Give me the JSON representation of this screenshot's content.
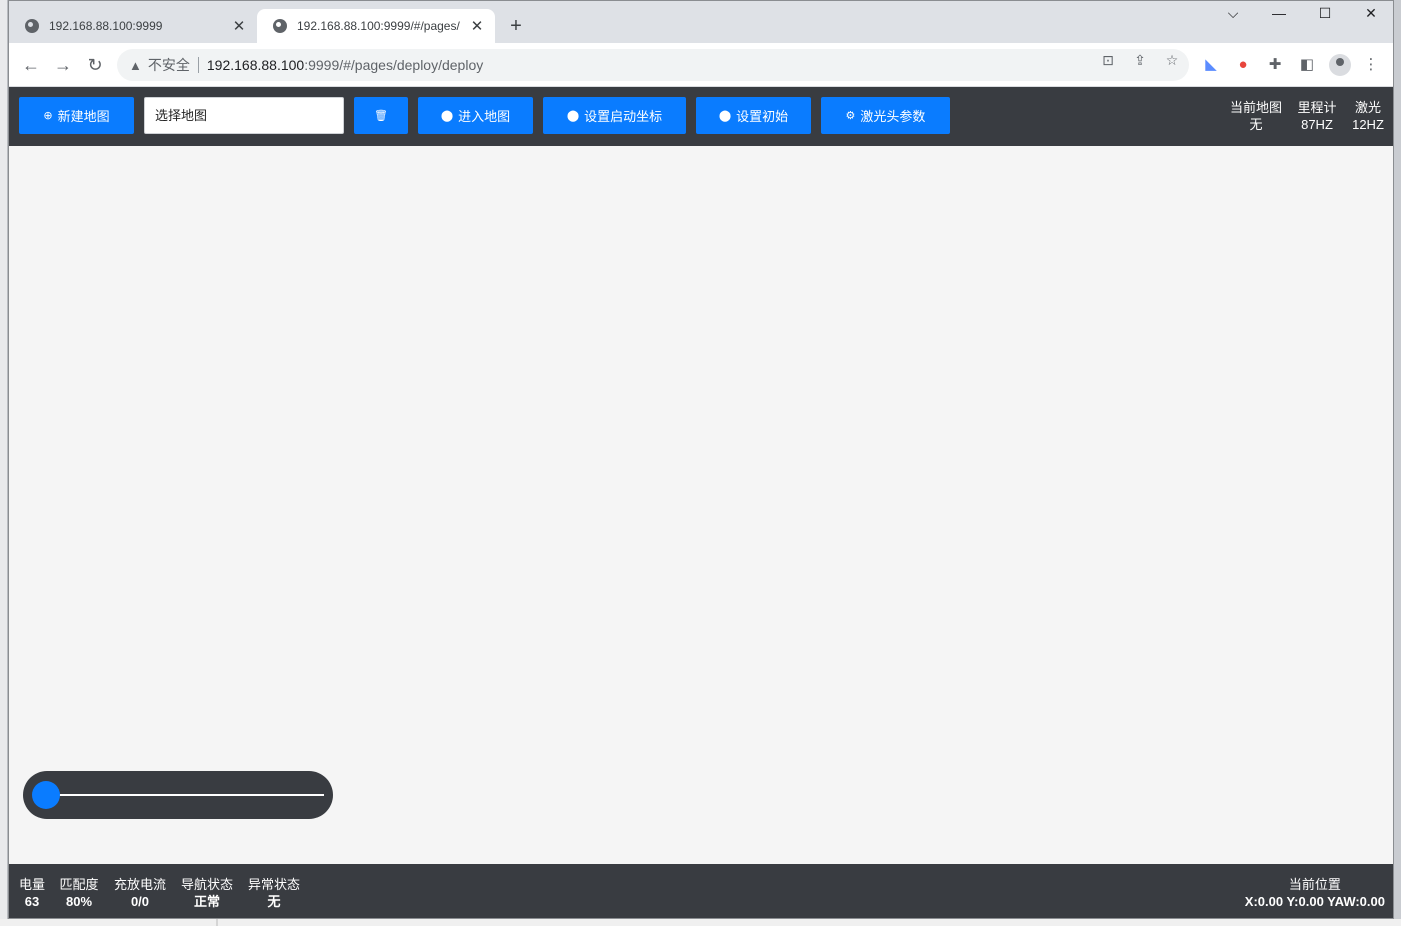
{
  "browser": {
    "tabs": [
      {
        "title": "192.168.88.100:9999"
      },
      {
        "title": "192.168.88.100:9999/#/pages/"
      }
    ],
    "address": {
      "insecure_label": "不安全",
      "host": "192.168.88.100",
      "path": ":9999/#/pages/deploy/deploy"
    }
  },
  "header": {
    "new_map": "新建地图",
    "map_select_placeholder": "选择地图",
    "enter_map": "进入地图",
    "set_start_coord": "设置启动坐标",
    "set_initial": "设置初始",
    "laser_params": "激光头参数",
    "stats": [
      {
        "label": "当前地图",
        "value": "无"
      },
      {
        "label": "里程计",
        "value": "87HZ"
      },
      {
        "label": "激光",
        "value": "12HZ"
      }
    ]
  },
  "slider": {
    "level": 0
  },
  "footer": {
    "stats": [
      {
        "label": "电量",
        "value": "63"
      },
      {
        "label": "匹配度",
        "value": "80%"
      },
      {
        "label": "充放电流",
        "value": "0/0"
      },
      {
        "label": "导航状态",
        "value": "正常"
      },
      {
        "label": "异常状态",
        "value": "无"
      }
    ],
    "position_label": "当前位置",
    "position_value": "X:0.00 Y:0.00 YAW:0.00"
  },
  "colors": {
    "accent": "#0a7cff",
    "bar": "#393c41",
    "canvas": "#f5f5f5"
  }
}
